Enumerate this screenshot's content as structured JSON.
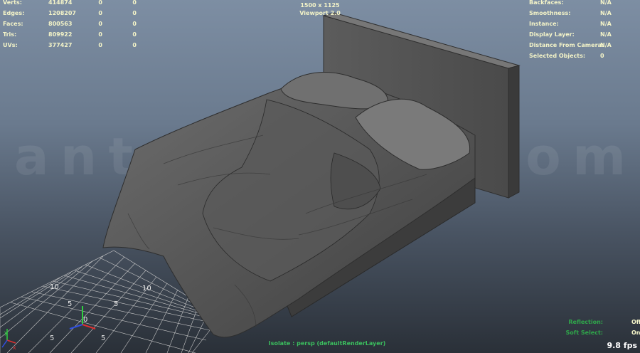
{
  "stats": [
    {
      "label": "Verts:",
      "v1": "414874",
      "v2": "0",
      "v3": "0"
    },
    {
      "label": "Edges:",
      "v1": "1208207",
      "v2": "0",
      "v3": "0"
    },
    {
      "label": "Faces:",
      "v1": "800563",
      "v2": "0",
      "v3": "0"
    },
    {
      "label": "Tris:",
      "v1": "809922",
      "v2": "0",
      "v3": "0"
    },
    {
      "label": "UVs:",
      "v1": "377427",
      "v2": "0",
      "v3": "0"
    }
  ],
  "viewport": {
    "resolution": "1500 x 1125",
    "name": "Viewport 2.0"
  },
  "info": [
    {
      "label": "Backfaces:",
      "value": "N/A"
    },
    {
      "label": "Smoothness:",
      "value": "N/A"
    },
    {
      "label": "Instance:",
      "value": "N/A"
    },
    {
      "label": "Display Layer:",
      "value": "N/A"
    },
    {
      "label": "Distance From Camera:",
      "value": "N/A"
    },
    {
      "label": "Selected Objects:",
      "value": "0"
    }
  ],
  "watermark": "antonioaxo.com",
  "grid_labels": {
    "ten_left": "10",
    "ten_right": "10",
    "five_a": "5",
    "five_b": "5",
    "five_c": "5",
    "five_d": "5",
    "zero": "0"
  },
  "axis_labels": {
    "x": "x",
    "y": "y"
  },
  "isolate": "Isolate : persp (defaultRenderLayer)",
  "bottom_right": [
    {
      "label": "Reflection:",
      "value": "Off"
    },
    {
      "label": "Soft Select:",
      "value": "On"
    }
  ],
  "fps": "9.8 fps",
  "colors": {
    "hud_text": "#f4f4c8",
    "status_green": "#2fa64a",
    "axis_x": "#e03030",
    "axis_y": "#30d040",
    "axis_z": "#3050e0"
  }
}
